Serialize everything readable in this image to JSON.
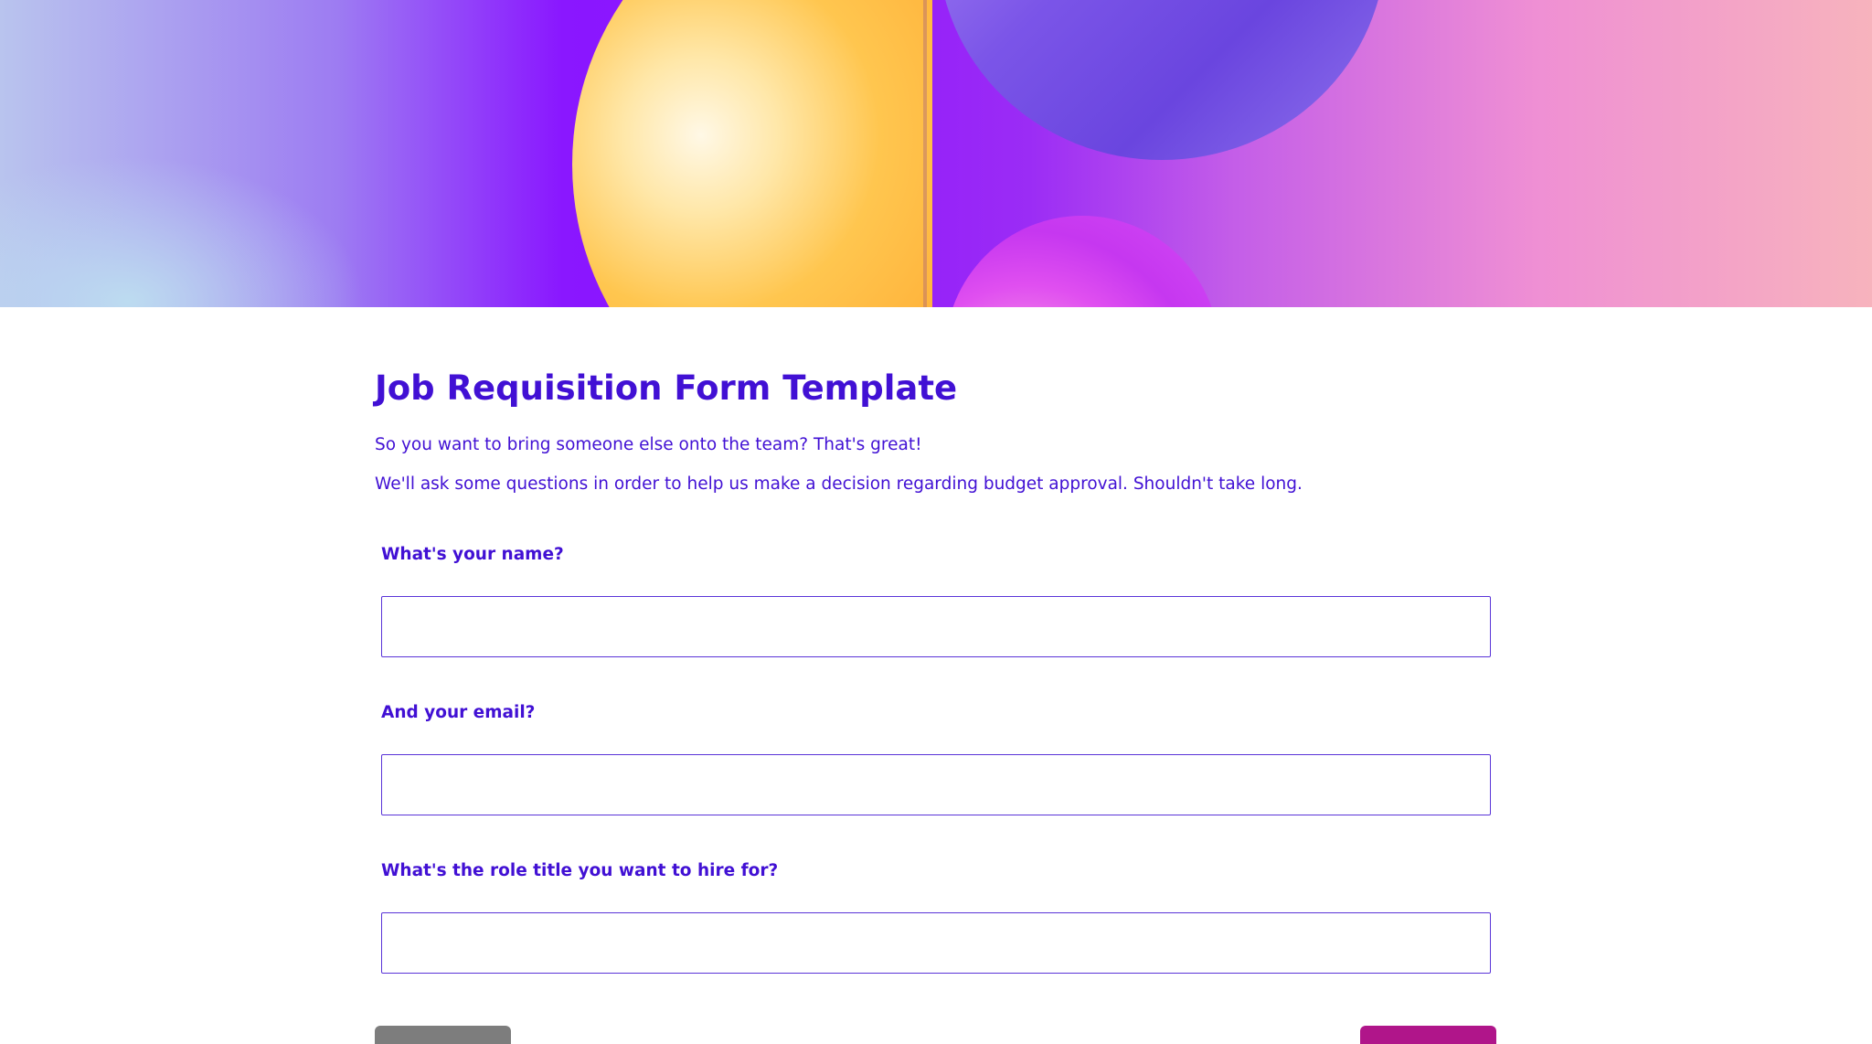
{
  "form": {
    "title": "Job Requisition Form Template",
    "intro_line_1": "So you want to bring someone else onto the team? That's great!",
    "intro_line_2": "We'll ask some questions in order to help us make a decision regarding budget approval. Shouldn't take long."
  },
  "questions": [
    {
      "label": "What's your name?",
      "value": ""
    },
    {
      "label": "And your email?",
      "value": ""
    },
    {
      "label": "What's the role title you want to hire for?",
      "value": ""
    }
  ],
  "colors": {
    "accent": "#4110d4",
    "input_border": "#5a34d8",
    "previous_button": "#7d7d7d",
    "next_button": "#b0158a"
  }
}
